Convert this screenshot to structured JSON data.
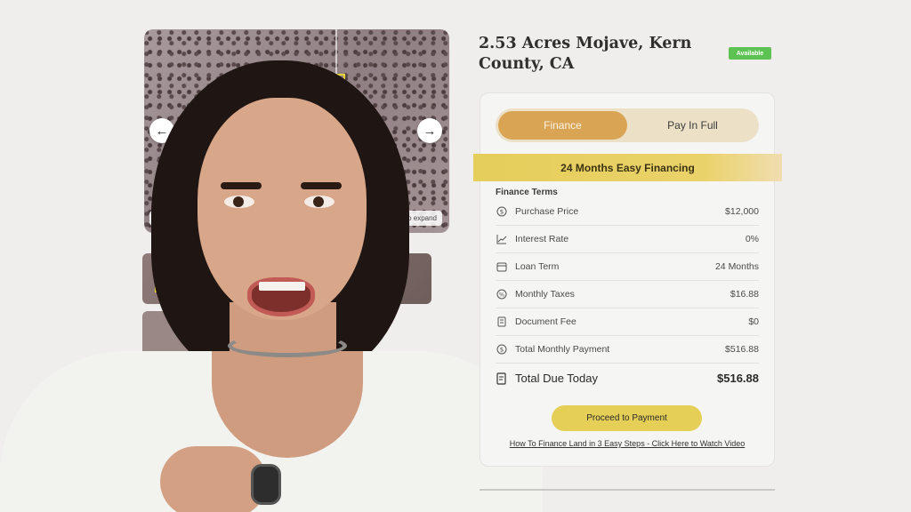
{
  "listing": {
    "title": "2.53 Acres Mojave, Kern County, CA",
    "status_badge": "Available"
  },
  "gallery": {
    "prev_icon": "←",
    "next_icon": "→",
    "view_chip": "Vie",
    "expand_chip": "k to expand"
  },
  "payment_toggle": {
    "finance_label": "Finance",
    "pay_in_full_label": "Pay In Full",
    "selected": "Finance"
  },
  "financing_banner": "24 Months Easy Financing",
  "finance_terms": {
    "heading": "Finance Terms",
    "rows": [
      {
        "icon": "dollar-circle-icon",
        "label": "Purchase Price",
        "value": "$12,000"
      },
      {
        "icon": "chart-line-icon",
        "label": "Interest Rate",
        "value": "0%"
      },
      {
        "icon": "calendar-icon",
        "label": "Loan Term",
        "value": "24 Months"
      },
      {
        "icon": "percent-badge-icon",
        "label": "Monthly Taxes",
        "value": "$16.88"
      },
      {
        "icon": "document-icon",
        "label": "Document Fee",
        "value": "$0"
      },
      {
        "icon": "dollar-circle-icon",
        "label": "Total Monthly Payment",
        "value": "$516.88"
      }
    ],
    "total": {
      "icon": "receipt-icon",
      "label": "Total Due Today",
      "value": "$516.88"
    }
  },
  "proceed_button": "Proceed to Payment",
  "video_link": "How To Finance Land in 3 Easy Steps - Click Here to Watch Video",
  "colors": {
    "accent_finance": "#d9a454",
    "banner_yellow": "#e5ce5a",
    "badge_green": "#5cc352",
    "button_yellow": "#e5cf56"
  }
}
